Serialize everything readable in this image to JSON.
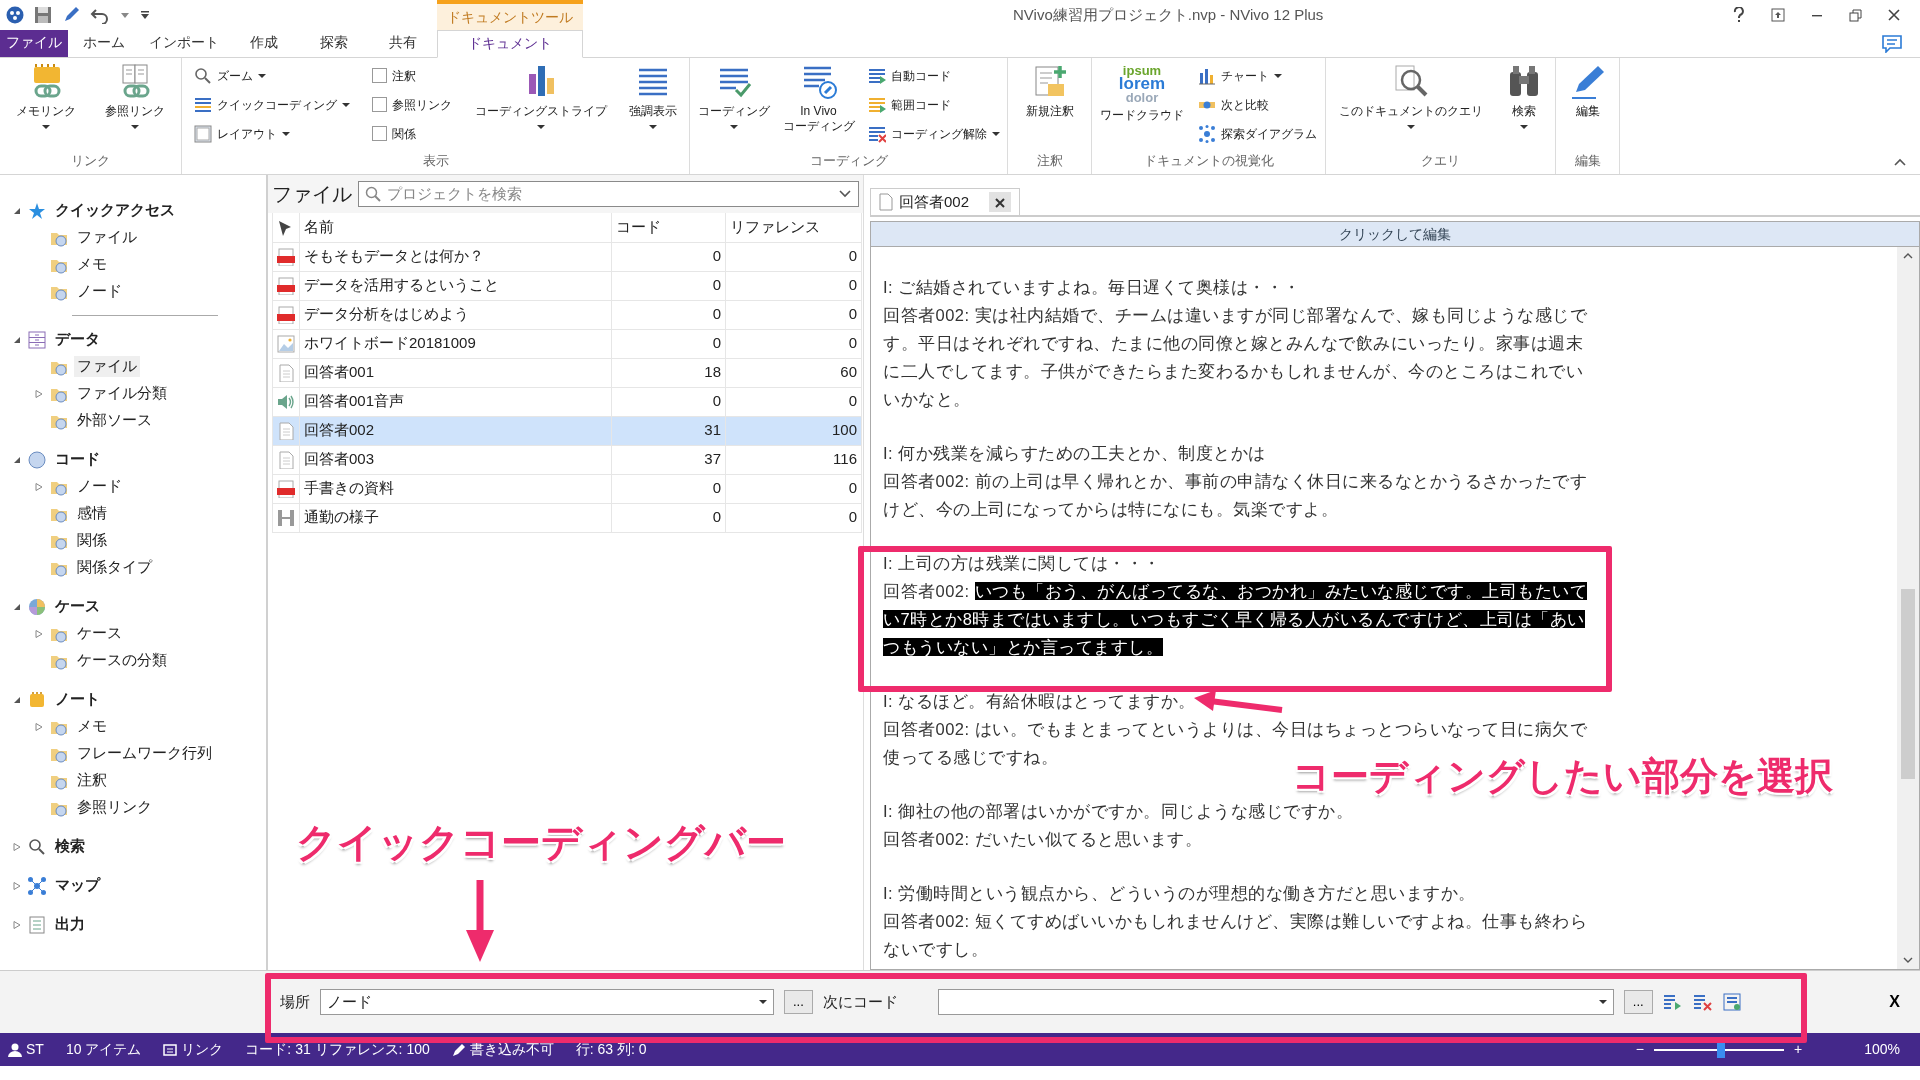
{
  "window": {
    "title": "NVivo練習用プロジェクト.nvp - NVivo 12 Plus"
  },
  "context_tab_label": "ドキュメントツール",
  "ribbon_tabs": [
    {
      "label": "ファイル",
      "kind": "file",
      "selected": false
    },
    {
      "label": "ホーム",
      "kind": "tab",
      "selected": false
    },
    {
      "label": "インポート",
      "kind": "tab",
      "selected": false
    },
    {
      "label": "作成",
      "kind": "tab",
      "selected": false
    },
    {
      "label": "探索",
      "kind": "tab",
      "selected": false
    },
    {
      "label": "共有",
      "kind": "tab",
      "selected": false
    },
    {
      "label": "ドキュメント",
      "kind": "tab",
      "selected": true
    }
  ],
  "ribbon_groups": [
    {
      "label": "リンク",
      "items": [
        {
          "kind": "large",
          "label_lines": [
            "メモリンク"
          ],
          "dropdown": true
        },
        {
          "kind": "large",
          "label_lines": [
            "参照リンク"
          ],
          "dropdown": true
        }
      ]
    },
    {
      "label": "表示",
      "items": [
        {
          "kind": "small",
          "label": "ズーム",
          "dropdown": true
        },
        {
          "kind": "small",
          "label": "クイックコーディング",
          "dropdown": true
        },
        {
          "kind": "small",
          "label": "レイアウト",
          "dropdown": true
        },
        {
          "kind": "check",
          "label": "注釈",
          "checked": false
        },
        {
          "kind": "check",
          "label": "参照リンク",
          "checked": false
        },
        {
          "kind": "check",
          "label": "関係",
          "checked": false
        },
        {
          "kind": "large",
          "label_lines": [
            "コーディングストライプ"
          ],
          "dropdown": true
        },
        {
          "kind": "large",
          "label_lines": [
            "強調表示"
          ],
          "dropdown": true
        }
      ]
    },
    {
      "label": "コーディング",
      "items": [
        {
          "kind": "large",
          "label_lines": [
            "コーディング"
          ],
          "dropdown": true
        },
        {
          "kind": "large",
          "label_lines": [
            "In Vivo",
            "コーディング"
          ],
          "dropdown": false
        },
        {
          "kind": "small",
          "label": "自動コード",
          "dropdown": false
        },
        {
          "kind": "small",
          "label": "範囲コード",
          "dropdown": false
        },
        {
          "kind": "small",
          "label": "コーディング解除",
          "dropdown": true
        }
      ]
    },
    {
      "label": "注釈",
      "items": [
        {
          "kind": "large",
          "label_lines": [
            "新規注釈"
          ],
          "dropdown": false
        }
      ]
    },
    {
      "label": "ドキュメントの視覚化",
      "items": [
        {
          "kind": "large",
          "label_lines": [
            "ワードクラウド"
          ],
          "dropdown": false,
          "icon_text": [
            "ipsum",
            "lorem",
            "dolor"
          ]
        },
        {
          "kind": "small",
          "label": "チャート",
          "dropdown": true
        },
        {
          "kind": "small",
          "label": "次と比較",
          "dropdown": false
        },
        {
          "kind": "small",
          "label": "探索ダイアグラム",
          "dropdown": false
        }
      ]
    },
    {
      "label": "クエリ",
      "items": [
        {
          "kind": "large",
          "label_lines": [
            "このドキュメントのクエリ"
          ],
          "dropdown": true
        },
        {
          "kind": "large",
          "label_lines": [
            "検索"
          ],
          "dropdown": true
        }
      ]
    },
    {
      "label": "編集",
      "items": [
        {
          "kind": "large",
          "label_lines": [
            "編集"
          ],
          "dropdown": false
        }
      ]
    }
  ],
  "navigation": [
    {
      "label": "クイックアクセス",
      "expanded": true,
      "selected": false,
      "children": [
        {
          "label": "ファイル",
          "selected": false
        },
        {
          "label": "メモ",
          "selected": false
        },
        {
          "label": "ノード",
          "selected": false
        }
      ]
    },
    {
      "label": "データ",
      "expanded": true,
      "selected": false,
      "children": [
        {
          "label": "ファイル",
          "selected": true
        },
        {
          "label": "ファイル分類",
          "expanded": false,
          "selected": false
        },
        {
          "label": "外部ソース",
          "selected": false
        }
      ]
    },
    {
      "label": "コード",
      "expanded": true,
      "selected": false,
      "children": [
        {
          "label": "ノード",
          "expanded": false,
          "selected": false
        },
        {
          "label": "感情",
          "selected": false
        },
        {
          "label": "関係",
          "selected": false
        },
        {
          "label": "関係タイプ",
          "selected": false
        }
      ]
    },
    {
      "label": "ケース",
      "expanded": true,
      "selected": false,
      "children": [
        {
          "label": "ケース",
          "expanded": false,
          "selected": false
        },
        {
          "label": "ケースの分類",
          "selected": false
        }
      ]
    },
    {
      "label": "ノート",
      "expanded": true,
      "selected": false,
      "children": [
        {
          "label": "メモ",
          "expanded": false,
          "selected": false
        },
        {
          "label": "フレームワーク行列",
          "selected": false
        },
        {
          "label": "注釈",
          "selected": false
        },
        {
          "label": "参照リンク",
          "selected": false
        }
      ]
    },
    {
      "label": "検索",
      "expanded": false,
      "selected": false
    },
    {
      "label": "マップ",
      "expanded": false,
      "selected": false
    },
    {
      "label": "出力",
      "expanded": false,
      "selected": false
    }
  ],
  "file_pane": {
    "title": "ファイル",
    "search": {
      "placeholder": "プロジェクトを検索"
    },
    "columns": [
      "名前",
      "コード",
      "リファレンス"
    ],
    "rows": [
      {
        "kind": "pdf",
        "name": "そもそもデータとは何か？",
        "codes": "0",
        "references": "0",
        "selected": false
      },
      {
        "kind": "pdf",
        "name": "データを活用するということ",
        "codes": "0",
        "references": "0",
        "selected": false
      },
      {
        "kind": "pdf",
        "name": "データ分析をはじめよう",
        "codes": "0",
        "references": "0",
        "selected": false
      },
      {
        "kind": "image",
        "name": "ホワイトボード20181009",
        "codes": "0",
        "references": "0",
        "selected": false
      },
      {
        "kind": "document",
        "name": "回答者001",
        "codes": "18",
        "references": "60",
        "selected": false
      },
      {
        "kind": "audio",
        "name": "回答者001音声",
        "codes": "0",
        "references": "0",
        "selected": false
      },
      {
        "kind": "document",
        "name": "回答者002",
        "codes": "31",
        "references": "100",
        "selected": true
      },
      {
        "kind": "document",
        "name": "回答者003",
        "codes": "37",
        "references": "116",
        "selected": false
      },
      {
        "kind": "pdf",
        "name": "手書きの資料",
        "codes": "0",
        "references": "0",
        "selected": false
      },
      {
        "kind": "video",
        "name": "通勤の様子",
        "codes": "0",
        "references": "0",
        "selected": false
      }
    ]
  },
  "document": {
    "tab": "回答者002",
    "edit_bar": "クリックして編集",
    "exchanges": [
      [
        {
          "speaker": "I:",
          "text": "ご結婚されていますよね。毎日遅くて奥様は・・・",
          "selected": false
        },
        {
          "speaker": "回答者002:",
          "text": "実は社内結婚で、チームは違いますが同じ部署なんで、嫁も同じような感じです。平日はそれぞれですね、たまに他の同僚と嫁とみんなで飲みにいったり。家事は週末に二人でしてます。子供ができたらまた変わるかもしれませんが、今のところはこれでいいかなと。",
          "selected": false
        }
      ],
      [
        {
          "speaker": "I:",
          "text": "何か残業を減らすための工夫とか、制度とかは",
          "selected": false
        },
        {
          "speaker": "回答者002:",
          "text": "前の上司は早く帰れとか、事前の申請なく休日に来るなとかうるさかったですけど、今の上司になってからは特になにも。気楽ですよ。",
          "selected": false
        }
      ],
      [
        {
          "speaker": "I:",
          "text": "上司の方は残業に関しては・・・",
          "selected": false
        },
        {
          "speaker": "回答者002:",
          "text": "いつも「おう、がんばってるな、おつかれ」みたいな感じです。上司もたいてい7時とか8時まではいますし。いつもすごく早く帰る人がいるんですけど、上司は「あいつもういない」とか言ってますし。",
          "selected": true
        }
      ],
      [
        {
          "speaker": "I:",
          "text": "なるほど。有給休暇はとってますか。",
          "selected": false
        },
        {
          "speaker": "回答者002:",
          "text": "はい。でもまとまってというよりは、今日はちょっとつらいなって日に病欠で使ってる感じですね。",
          "selected": false
        }
      ],
      [
        {
          "speaker": "I:",
          "text": "御社の他の部署はいかがですか。同じような感じですか。",
          "selected": false
        },
        {
          "speaker": "回答者002:",
          "text": "だいたい似てると思います。",
          "selected": false
        }
      ],
      [
        {
          "speaker": "I:",
          "text": "労働時間という観点から、どういうのが理想的な働き方だと思いますか。",
          "selected": false
        },
        {
          "speaker": "回答者002:",
          "text": "短くてすめばいいかもしれませんけど、実際は難しいですよね。仕事も終わらないですし。",
          "selected": false
        }
      ]
    ]
  },
  "quick_coding_bar": {
    "location_label": "場所",
    "location_value": "ノード",
    "browse_button": "...",
    "code_label": "次にコード",
    "code_browse_button": "...",
    "close": "X"
  },
  "status_bar": {
    "user": "ST",
    "items": "10 アイテム",
    "link": "リンク",
    "counts": "コード: 31 リファレンス: 100",
    "write": "書き込み不可",
    "position": "行: 63 列: 0",
    "zoom_minus": "−",
    "zoom_plus": "+",
    "zoom_slider": {
      "level": 0.52
    },
    "zoom_reading": "100%"
  },
  "annotations": {
    "selection_callout": "コーディングしたい部分を選択",
    "bar_callout": "クイックコーディングバー"
  }
}
